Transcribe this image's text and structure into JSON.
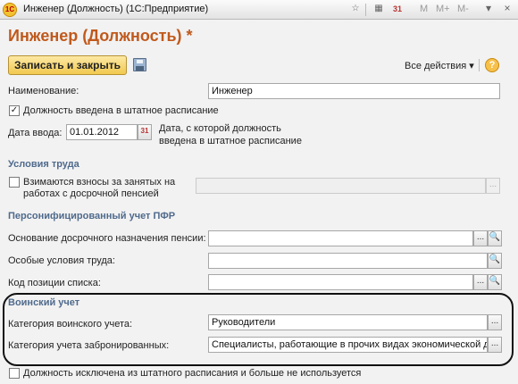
{
  "window": {
    "title": "Инженер (Должность)  (1С:Предприятие)",
    "memory_buttons": [
      "M",
      "M+",
      "M-"
    ]
  },
  "form": {
    "title": "Инженер (Должность) *",
    "save_close_label": "Записать и закрыть",
    "all_actions_label": "Все действия",
    "help_label": "?"
  },
  "fields": {
    "name_label": "Наименование:",
    "name_value": "Инженер",
    "staff_checkbox_label": "Должность введена в штатное расписание",
    "date_label": "Дата ввода:",
    "date_value": "01.01.2012",
    "date_note_line1": "Дата, с которой должность",
    "date_note_line2": "введена в штатное расписание"
  },
  "work_conditions": {
    "title": "Условия труда",
    "contrib_label_line1": "Взимаются взносы за занятых на",
    "contrib_label_line2": "работах с досрочной пенсией"
  },
  "pfr": {
    "title": "Персонифицированный учет ПФР",
    "pension_label": "Основание досрочного назначения пенсии:",
    "special_label": "Особые условия труда:",
    "list_code_label": "Код позиции списка:"
  },
  "military": {
    "title": "Воинский учет",
    "category_label": "Категория воинского учета:",
    "category_value": "Руководители",
    "reserved_label": "Категория учета забронированных:",
    "reserved_value": "Специалисты, работающие в прочих видах экономической д"
  },
  "footer": {
    "excluded_label": "Должность исключена из штатного расписания и больше не используется"
  },
  "glyphs": {
    "dots": "...",
    "search": "🔍",
    "check": "✓",
    "dropdown": "▾",
    "calendar_label": "31"
  }
}
